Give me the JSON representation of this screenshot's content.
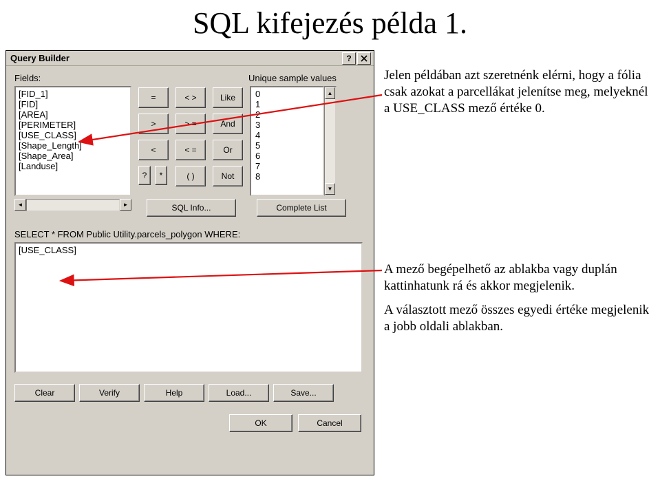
{
  "page_title": "SQL kifejezés példa 1.",
  "dialog": {
    "title": "Query Builder",
    "fields_label": "Fields:",
    "unique_label": "Unique sample values",
    "fields": [
      "[FID_1]",
      "[FID]",
      "[AREA]",
      "[PERIMETER]",
      "[USE_CLASS]",
      "[Shape_Length]",
      "[Shape_Area]",
      "[Landuse]"
    ],
    "ops": [
      "=",
      "< >",
      "Like",
      ">",
      "> =",
      "And",
      "<",
      "< =",
      "Or",
      "?",
      "*",
      "( )",
      "Not"
    ],
    "values": [
      "0",
      "1",
      "2",
      "3",
      "4",
      "5",
      "6",
      "7",
      "8"
    ],
    "sql_info": "SQL Info...",
    "complete_list": "Complete List",
    "select_text": "SELECT * FROM Public Utility.parcels_polygon WHERE:",
    "where_value": "[USE_CLASS]",
    "bottom_buttons": [
      "Clear",
      "Verify",
      "Help",
      "Load...",
      "Save..."
    ],
    "ok": "OK",
    "cancel": "Cancel",
    "help_btn": "?",
    "close_btn": "×"
  },
  "annotations": {
    "a1": "Jelen példában azt szeretnénk elérni, hogy a fólia csak azokat a parcellákat jelenítse meg, melyeknél a USE_CLASS mező értéke 0.",
    "a2": "A mező begépelhető az ablakba vagy duplán kattinhatunk rá és akkor megjelenik.",
    "a3": "A választott mező összes egyedi értéke megjelenik a jobb oldali  ablakban."
  }
}
